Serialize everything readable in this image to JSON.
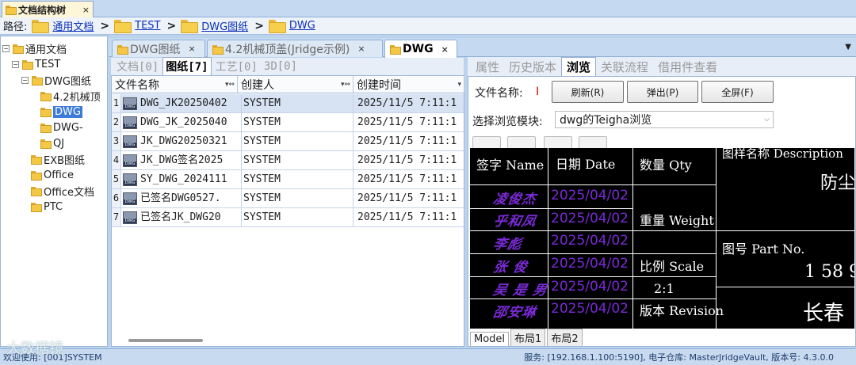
{
  "doc_tab": {
    "title": "文档结构树",
    "close": "×"
  },
  "path_bar": {
    "label": "路径:",
    "crumbs": [
      "通用文档",
      "TEST",
      "DWG图纸",
      "DWG"
    ]
  },
  "tree": {
    "nodes": [
      {
        "label": "通用文档",
        "level": 0,
        "expander": "−"
      },
      {
        "label": "TEST",
        "level": 1,
        "expander": "−"
      },
      {
        "label": "DWG图纸",
        "level": 2,
        "expander": "−"
      },
      {
        "label": "4.2机械顶",
        "level": 3
      },
      {
        "label": "DWG",
        "level": 3,
        "selected": true
      },
      {
        "label": "DWG-",
        "level": 3
      },
      {
        "label": "QJ",
        "level": 3
      },
      {
        "label": "EXB图纸",
        "level": 2
      },
      {
        "label": "Office",
        "level": 2
      },
      {
        "label": "Office文档",
        "level": 2
      },
      {
        "label": "PTC",
        "level": 2
      }
    ]
  },
  "main_tabs": [
    {
      "label": "DWG图纸",
      "close": "×"
    },
    {
      "label": "4.2机械顶盖(Jridge示例)",
      "close": "×"
    },
    {
      "label": "DWG",
      "close": "×",
      "active": true
    }
  ],
  "sub_tabs": [
    {
      "label": "文档[0]"
    },
    {
      "label": "图纸[7]",
      "active": true
    },
    {
      "label": "工艺[0]"
    },
    {
      "label": "3D[0]"
    }
  ],
  "grid": {
    "headers": [
      "文件名称",
      "创建人",
      "创建时间"
    ],
    "rows": [
      {
        "num": "1",
        "name": "DWG_JK20250402",
        "creator": "SYSTEM",
        "time": "2025/11/5 7:11:1",
        "selected": true
      },
      {
        "num": "2",
        "name": "DWG_JK_2025040",
        "creator": "SYSTEM",
        "time": "2025/11/5 7:11:1"
      },
      {
        "num": "3",
        "name": "JK_DWG20250321",
        "creator": "SYSTEM",
        "time": "2025/11/5 7:11:1"
      },
      {
        "num": "4",
        "name": "JK_DWG签名2025",
        "creator": "SYSTEM",
        "time": "2025/11/5 7:11:1"
      },
      {
        "num": "5",
        "name": "SY_DWG_2024111",
        "creator": "SYSTEM",
        "time": "2025/11/5 7:11:1"
      },
      {
        "num": "6",
        "name": "已签名DWG0527.",
        "creator": "SYSTEM",
        "time": "2025/11/5 7:11:1"
      },
      {
        "num": "7",
        "name": "已签名JK_DWG20",
        "creator": "SYSTEM",
        "time": "2025/11/5 7:11:1"
      }
    ]
  },
  "right_tabs": [
    {
      "label": "属性"
    },
    {
      "label": "历史版本"
    },
    {
      "label": "浏览",
      "active": true
    },
    {
      "label": "关联流程"
    },
    {
      "label": "借用件查看"
    }
  ],
  "browse": {
    "filename_label": "文件名称:",
    "filename_value": "I",
    "refresh": "刷新(R)",
    "popup": "弹出(P)",
    "fullscreen": "全屏(F)",
    "module_label": "选择浏览模块:",
    "module_value": "dwg的Teigha浏览"
  },
  "cad": {
    "h_sign": "签字  Name",
    "h_date": "日期  Date",
    "h_qty": "数量 Qty",
    "h_desc": "图样名称  Description",
    "desc_value": "防尘",
    "signers": [
      "凌俊杰",
      "乎和凤",
      "李彪",
      "张 俊",
      "吴 是 男",
      "邵安琳"
    ],
    "dates": [
      "2025/04/02",
      "2025/04/02",
      "2025/04/02",
      "2025/04/02",
      "2025/04/02",
      "2025/04/02"
    ],
    "weight": "重量 Weight",
    "part_no_label": "图号 Part No.",
    "part_no_value": "1 58 9",
    "scale_label": "比例  Scale",
    "scale_value": "2:1",
    "revision": "版本 Revision",
    "company": "长春"
  },
  "layouts": [
    "Model",
    "布局1",
    "布局2"
  ],
  "status": {
    "left": "欢迎使用: [001]SYSTEM",
    "right": "服务: [192.168.1.100:5190], 电子仓库: MasterJridgeVault, 版本号: 4.3.0.0"
  },
  "watermark": "大数据镜"
}
